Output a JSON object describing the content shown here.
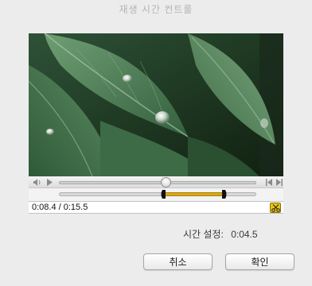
{
  "window": {
    "title": "재생 시간 컨트롤"
  },
  "player": {
    "timecode": "0:08.4 / 0:15.5",
    "playhead_fraction": 0.542,
    "trim_start_fraction": 0.542,
    "trim_end_fraction": 0.827,
    "trim_color": "#d9a818"
  },
  "duration": {
    "label": "시간 설정:",
    "value": "0:04.5"
  },
  "buttons": {
    "cancel": "취소",
    "ok": "확인"
  },
  "icons": {
    "volume": "volume-icon",
    "play": "play-icon",
    "prev": "previous-icon",
    "next": "next-icon",
    "trim": "scissors-icon"
  }
}
